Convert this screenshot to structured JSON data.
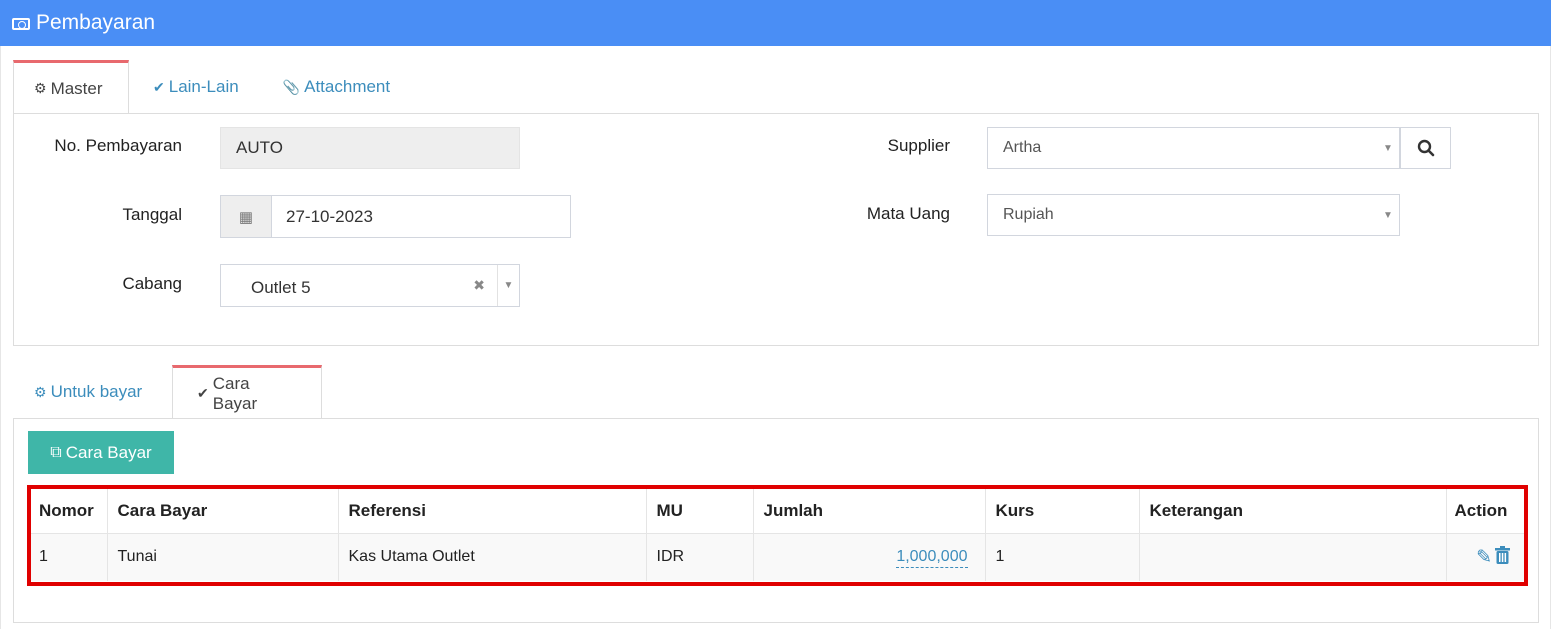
{
  "header": {
    "title": "Pembayaran",
    "icon": "money-icon"
  },
  "top_tabs": [
    {
      "label": "Master",
      "icon": "cogs-icon",
      "active": true
    },
    {
      "label": "Lain-Lain",
      "icon": "check-circle-icon",
      "active": false
    },
    {
      "label": "Attachment",
      "icon": "paperclip-icon",
      "active": false
    }
  ],
  "form": {
    "no_pembayaran": {
      "label": "No. Pembayaran",
      "value": "AUTO"
    },
    "tanggal": {
      "label": "Tanggal",
      "value": "27-10-2023"
    },
    "cabang": {
      "label": "Cabang",
      "value": "Outlet 5"
    },
    "supplier": {
      "label": "Supplier",
      "value": "Artha"
    },
    "mata_uang": {
      "label": "Mata Uang",
      "value": "Rupiah"
    }
  },
  "sub_tabs": [
    {
      "label": "Untuk bayar",
      "icon": "cogs-icon",
      "active": false
    },
    {
      "label": "Cara Bayar",
      "icon": "check-circle-icon",
      "active": true
    }
  ],
  "add_button": {
    "label": "Cara Bayar",
    "icon": "copy-icon"
  },
  "table": {
    "columns": [
      "Nomor",
      "Cara Bayar",
      "Referensi",
      "MU",
      "Jumlah",
      "Kurs",
      "Keterangan",
      "Action"
    ],
    "rows": [
      {
        "nomor": "1",
        "cara_bayar": "Tunai",
        "referensi": "Kas Utama Outlet",
        "mu": "IDR",
        "jumlah": "1,000,000",
        "kurs": "1",
        "keterangan": ""
      }
    ]
  },
  "colors": {
    "header": "#4a8ef5",
    "teal_button": "#3fb6a8",
    "active_tab_border": "#e8696e",
    "highlight_border": "#e00000",
    "link": "#3c8dbc"
  }
}
